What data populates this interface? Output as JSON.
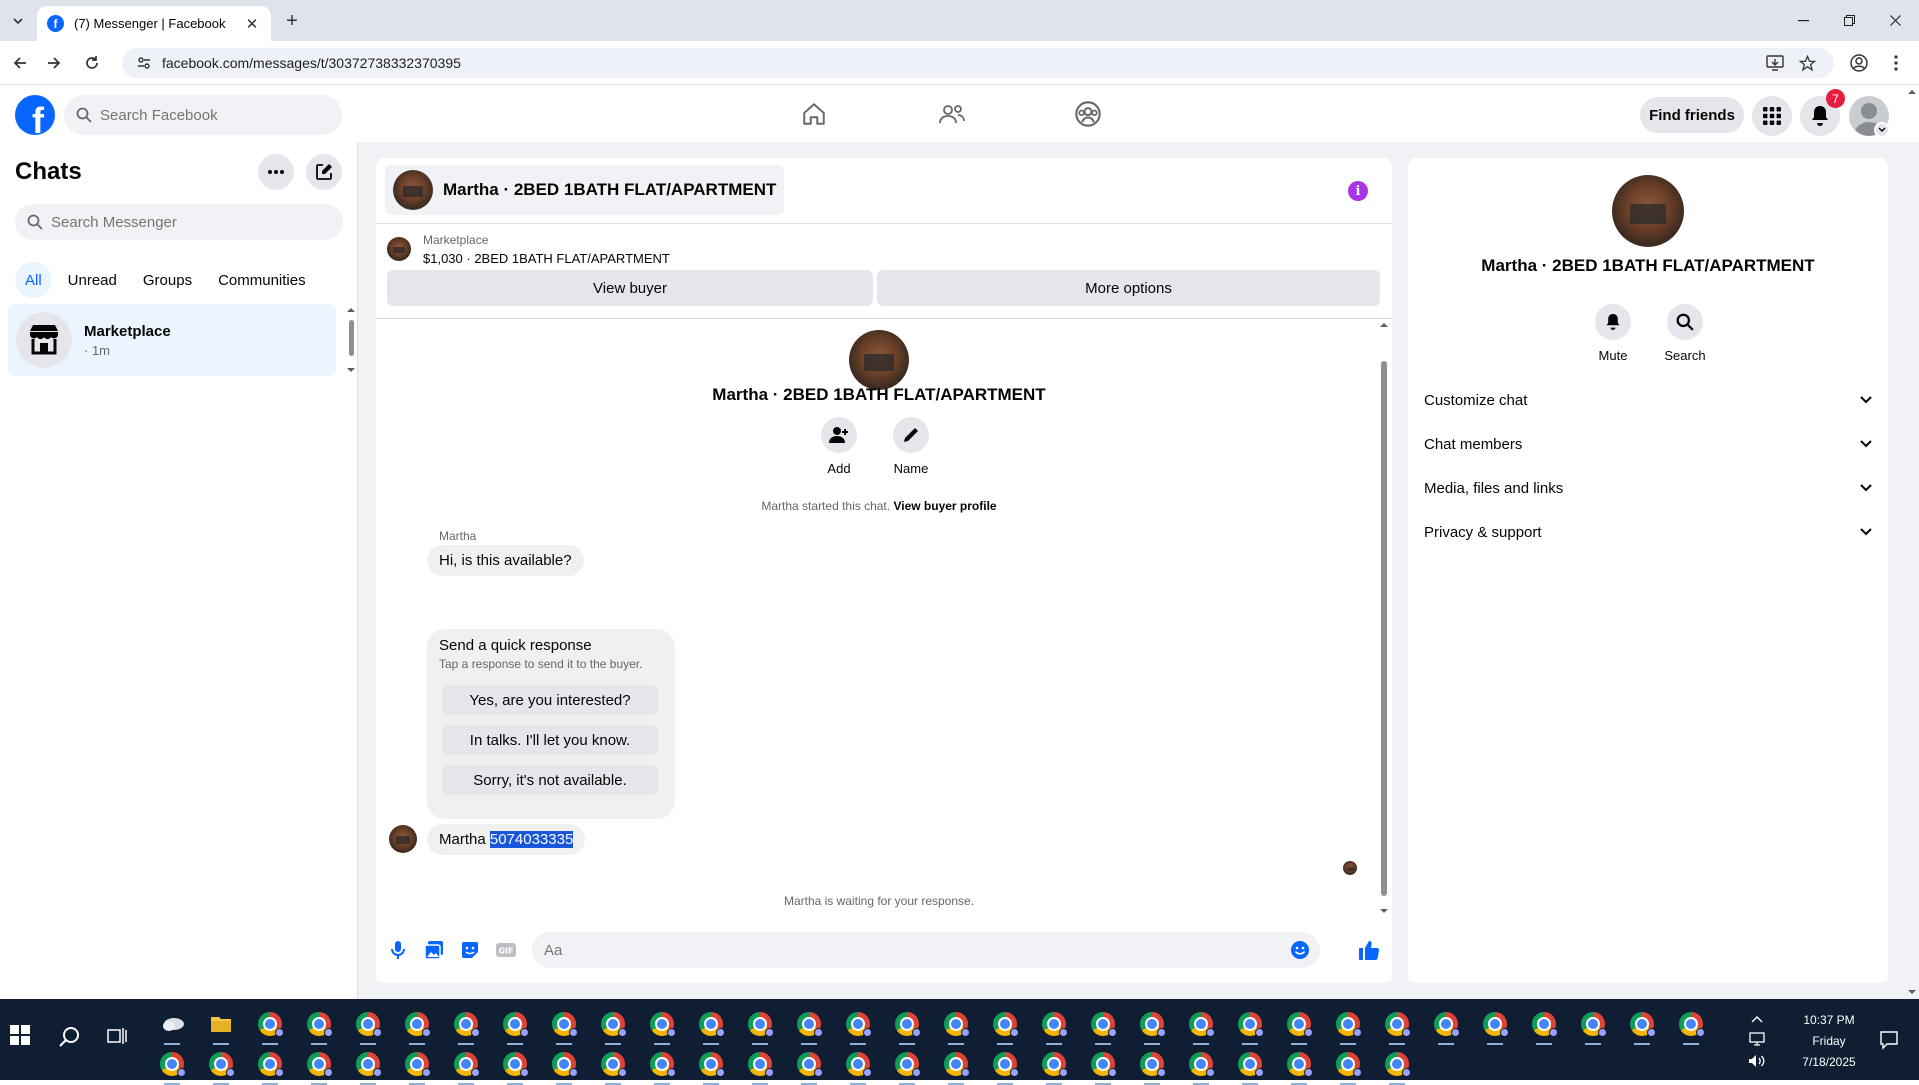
{
  "browser": {
    "tab_title": "(7) Messenger | Facebook",
    "url": "facebook.com/messages/t/30372738332370395",
    "new_tab_label": "+",
    "close_label": "✕"
  },
  "fb_header": {
    "search_placeholder": "Search Facebook",
    "find_friends": "Find friends",
    "notification_count": "7"
  },
  "sidebar": {
    "title": "Chats",
    "search_placeholder": "Search Messenger",
    "filters": [
      "All",
      "Unread",
      "Groups",
      "Communities"
    ],
    "active_filter": "All",
    "chats": [
      {
        "name": "Marketplace",
        "time": "· 1m"
      }
    ]
  },
  "conversation": {
    "title": "Martha · 2BED 1BATH FLAT/APARTMENT",
    "banner": {
      "label": "Marketplace",
      "listing": "$1,030 · 2BED 1BATH FLAT/APARTMENT",
      "view_buyer": "View buyer",
      "more_options": "More options"
    },
    "profile_name": "Martha · 2BED 1BATH FLAT/APARTMENT",
    "actions": [
      {
        "icon": "add-person-icon",
        "label": "Add"
      },
      {
        "icon": "pencil-icon",
        "label": "Name"
      }
    ],
    "system_message": "Martha started this chat.",
    "system_link": "View buyer profile",
    "sender_name": "Martha",
    "message_1": "Hi, is this available?",
    "quick_response": {
      "title": "Send a quick response",
      "subtitle": "Tap a response to send it to the buyer.",
      "options": [
        "Yes, are you interested?",
        "In talks. I'll let you know.",
        "Sorry, it's not available."
      ]
    },
    "message_2_prefix": "Martha",
    "message_2_selected": "5074033335",
    "waiting_text": "Martha is waiting for your response.",
    "composer_placeholder": "Aa"
  },
  "details_panel": {
    "name": "Martha · 2BED 1BATH FLAT/APARTMENT",
    "actions": [
      {
        "icon": "bell-icon",
        "label": "Mute"
      },
      {
        "icon": "search-icon",
        "label": "Search"
      }
    ],
    "sections": [
      "Customize chat",
      "Chat members",
      "Media, files and links",
      "Privacy & support"
    ]
  },
  "taskbar": {
    "time": "10:37 PM",
    "day": "Friday",
    "date": "7/18/2025"
  },
  "colors": {
    "facebook_blue": "#0866ff",
    "info_purple": "#a933e6",
    "badge_red": "#e41e3f",
    "selection_blue": "#1a56d9",
    "taskbar": "#0f1e33"
  }
}
